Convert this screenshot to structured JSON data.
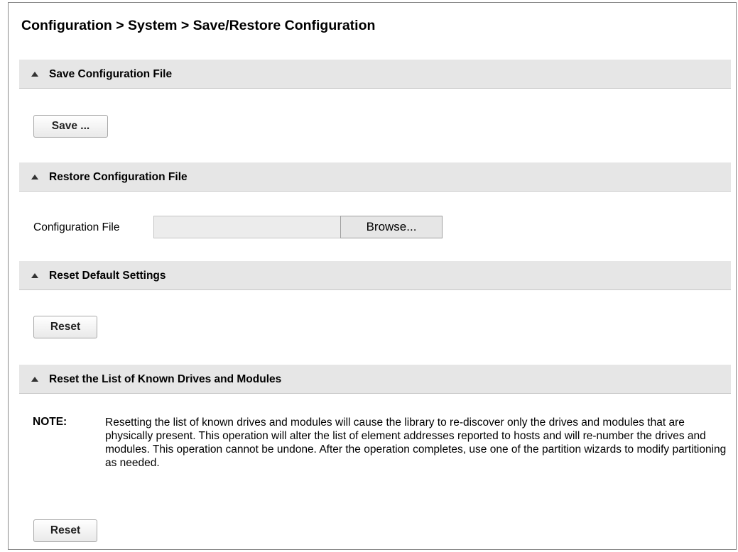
{
  "title": "Configuration > System > Save/Restore Configuration",
  "sections": {
    "save": {
      "header": "Save Configuration File",
      "button_label": "Save ..."
    },
    "restore": {
      "header": "Restore Configuration File",
      "field_label": "Configuration File",
      "field_value": "",
      "browse_label": "Browse..."
    },
    "reset_defaults": {
      "header": "Reset Default Settings",
      "button_label": "Reset"
    },
    "reset_known": {
      "header": "Reset the List of Known Drives and Modules",
      "note_label": "NOTE:",
      "note_text": "Resetting the list of known drives and modules will cause the library to re-discover only the drives and modules that are physically present. This operation will alter the list of element addresses reported to hosts and will re-number the drives and modules. This operation cannot be undone. After the operation completes, use one of the partition wizards to modify partitioning as needed.",
      "button_label": "Reset"
    }
  },
  "icons": {
    "collapse": "triangle-up-icon"
  },
  "colors": {
    "header_bg": "#e6e6e6",
    "border": "#8a8a8a"
  }
}
